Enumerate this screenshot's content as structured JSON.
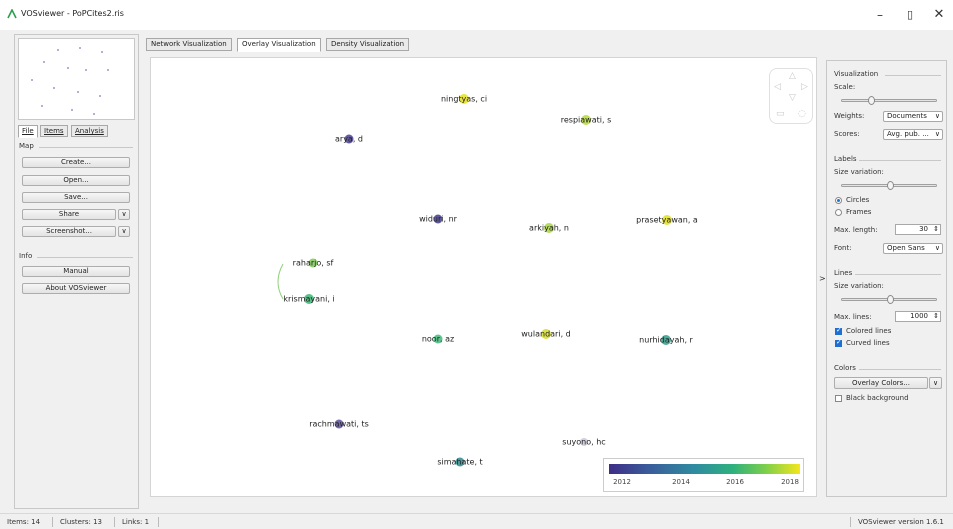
{
  "window": {
    "title": "VOSviewer - PoPCites2.ris",
    "minimize": "–",
    "maximize": "▯",
    "close": "✕"
  },
  "left": {
    "tabs": [
      "File",
      "Items",
      "Analysis"
    ],
    "map_section": "Map",
    "map_buttons": {
      "create": "Create...",
      "open": "Open...",
      "save": "Save...",
      "share": "Share",
      "screenshot": "Screenshot..."
    },
    "info_section": "Info",
    "info_buttons": {
      "manual": "Manual",
      "about": "About VOSviewer"
    },
    "dropdown_arrow": "∨"
  },
  "view_tabs": {
    "network": "Network Visualization",
    "overlay": "Overlay Visualization",
    "density": "Density Visualization"
  },
  "nodes": [
    {
      "label": "ningtyas, ci",
      "color": "#e8e01b"
    },
    {
      "label": "respiawati, s",
      "color": "#b5d93a"
    },
    {
      "label": "arya, d",
      "color": "#4a3e90"
    },
    {
      "label": "widuri, nr",
      "color": "#413a8a"
    },
    {
      "label": "arkiyah, n",
      "color": "#a9d544"
    },
    {
      "label": "prasetyawan, a",
      "color": "#e3df20"
    },
    {
      "label": "raharjo, sf",
      "color": "#7cca55"
    },
    {
      "label": "krismayani, i",
      "color": "#3db474"
    },
    {
      "label": "noor, az",
      "color": "#42b97a"
    },
    {
      "label": "wulandari, d",
      "color": "#d5dc28"
    },
    {
      "label": "nurhidayah, r",
      "color": "#2e9e8a"
    },
    {
      "label": "rachmawati, ts",
      "color": "#5d4fa0"
    },
    {
      "label": "suyono, hc",
      "color": "#c9c9d8"
    },
    {
      "label": "simahate, t",
      "color": "#2a8a8e"
    }
  ],
  "legend": {
    "ticks": [
      "2012",
      "2014",
      "2016",
      "2018"
    ]
  },
  "right": {
    "visualization": "Visualization",
    "scale": "Scale:",
    "weights_label": "Weights:",
    "weights_value": "Documents",
    "scores_label": "Scores:",
    "scores_value": "Avg. pub. ...",
    "labels": "Labels",
    "size_variation": "Size variation:",
    "circles": "Circles",
    "frames": "Frames",
    "max_length_label": "Max. length:",
    "max_length_value": "30",
    "font_label": "Font:",
    "font_value": "Open Sans",
    "lines": "Lines",
    "lines_size_variation": "Size variation:",
    "max_lines_label": "Max. lines:",
    "max_lines_value": "1000",
    "colored_lines": "Colored lines",
    "curved_lines": "Curved lines",
    "colors": "Colors",
    "overlay_colors": "Overlay Colors...",
    "black_background": "Black background",
    "caret": "∨",
    "spin": "⇕"
  },
  "status": {
    "items": "Items: 14",
    "clusters": "Clusters: 13",
    "links": "Links: 1",
    "version": "VOSviewer version 1.6.1"
  }
}
